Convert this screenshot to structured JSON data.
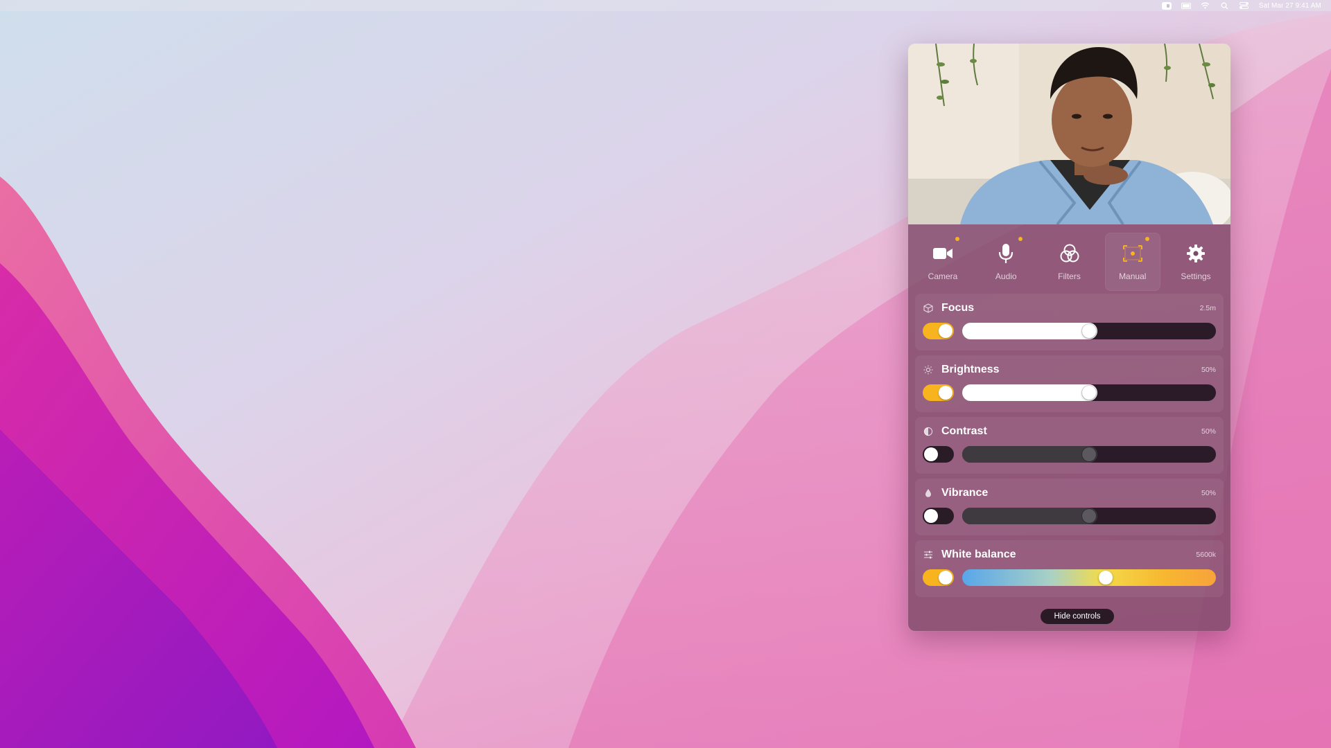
{
  "menubar": {
    "clock": "Sat Mar 27  9:41 AM",
    "icons": [
      "app-icon",
      "battery-icon",
      "wifi-icon",
      "search-icon",
      "control-center-icon"
    ]
  },
  "panel": {
    "video": {
      "alt": "camera-preview"
    },
    "tabs": [
      {
        "label": "Camera",
        "icon": "video-camera-icon",
        "indicator": true,
        "active": false
      },
      {
        "label": "Audio",
        "icon": "microphone-icon",
        "indicator": true,
        "active": false
      },
      {
        "label": "Filters",
        "icon": "filters-icon",
        "indicator": false,
        "active": false
      },
      {
        "label": "Manual",
        "icon": "manual-focus-icon",
        "indicator": true,
        "active": true
      },
      {
        "label": "Settings",
        "icon": "gear-icon",
        "indicator": false,
        "active": false
      }
    ],
    "controls": [
      {
        "label": "Focus",
        "value": "2.5m",
        "icon": "cube-icon",
        "enabled": true,
        "level": 0.5
      },
      {
        "label": "Brightness",
        "value": "50%",
        "icon": "sun-icon",
        "enabled": true,
        "level": 0.5
      },
      {
        "label": "Contrast",
        "value": "50%",
        "icon": "contrast-icon",
        "enabled": false,
        "level": 0.5
      },
      {
        "label": "Vibrance",
        "value": "50%",
        "icon": "droplet-icon",
        "enabled": false,
        "level": 0.5
      },
      {
        "label": "White balance",
        "value": "5600k",
        "icon": "sliders-icon",
        "enabled": true,
        "level": 0.57
      }
    ],
    "hide_controls_label": "Hide controls",
    "colors": {
      "accent": "#f7b41e",
      "indicator": "#f6b322"
    }
  }
}
